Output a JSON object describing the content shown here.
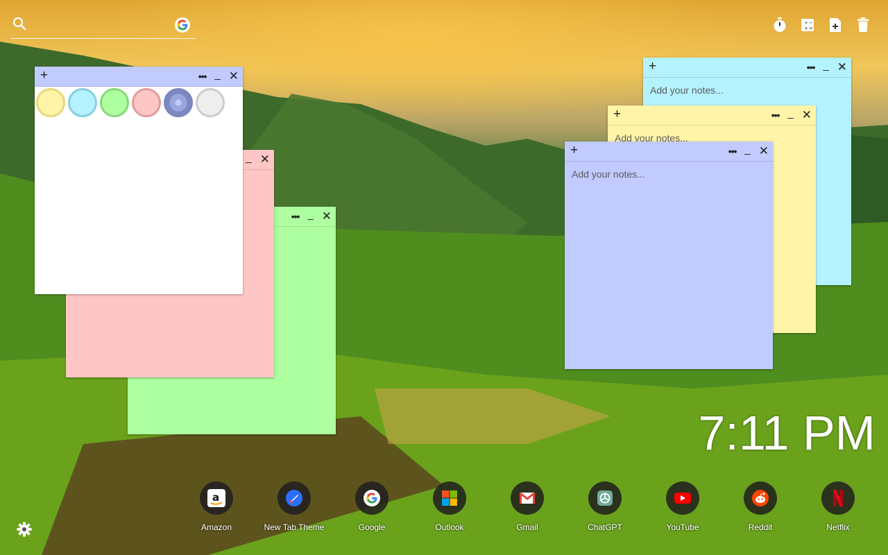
{
  "search": {
    "placeholder": ""
  },
  "top_icons": [
    "stopwatch-icon",
    "calculator-icon",
    "add-note-icon",
    "trash-icon"
  ],
  "notes": {
    "placeholder": "Add your notes...",
    "colors": {
      "white": "#ffffff",
      "pink": "#ffc6c6",
      "green": "#adffa0",
      "blue": "#c1cbff",
      "yellow": "#fff4a8",
      "cyan": "#b4f2ff"
    }
  },
  "palette": [
    "yellow",
    "cyan",
    "green",
    "pink",
    "periwinkle",
    "gray"
  ],
  "clock": {
    "time": "7:11 PM"
  },
  "dock": {
    "apps": [
      {
        "label": "Amazon",
        "icon": "amazon-icon"
      },
      {
        "label": "New Tab Theme",
        "icon": "new-tab-theme-icon"
      },
      {
        "label": "Google",
        "icon": "google-icon"
      },
      {
        "label": "Outlook",
        "icon": "outlook-icon"
      },
      {
        "label": "Gmail",
        "icon": "gmail-icon"
      },
      {
        "label": "ChatGPT",
        "icon": "chatgpt-icon"
      },
      {
        "label": "YouTube",
        "icon": "youtube-icon"
      },
      {
        "label": "Reddit",
        "icon": "reddit-icon"
      },
      {
        "label": "Netflix",
        "icon": "netflix-icon"
      }
    ]
  }
}
